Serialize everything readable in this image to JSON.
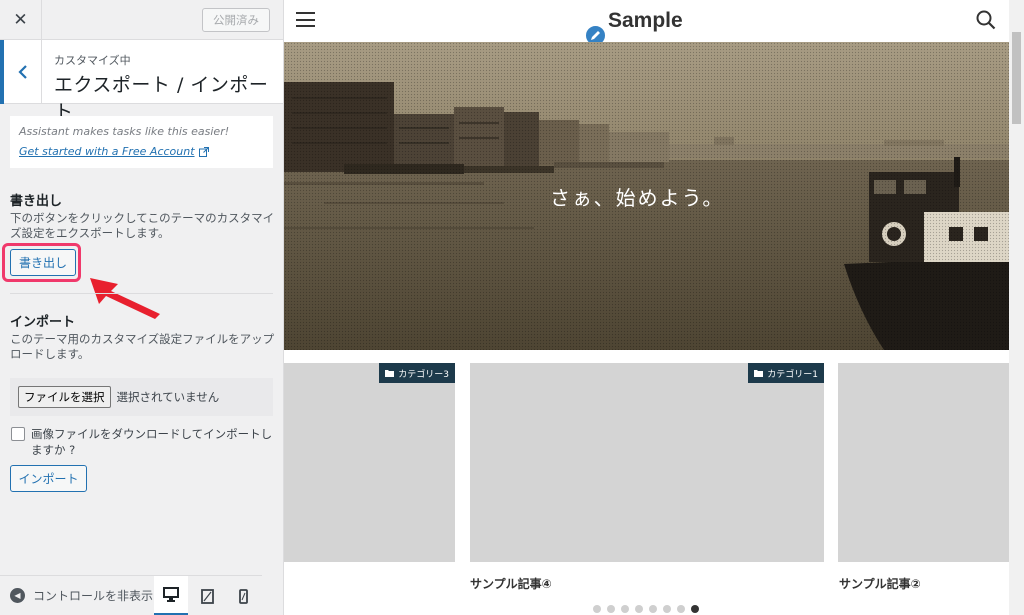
{
  "sidebar": {
    "close_label": "✕",
    "publish_label": "公開済み",
    "customizing_label": "カスタマイズ中",
    "section_title": "エクスポート / インポート",
    "assistant": {
      "text": "Assistant makes tasks like this easier!",
      "link": "Get started with a Free Account"
    },
    "export": {
      "title": "書き出し",
      "description": "下のボタンをクリックしてこのテーマのカスタマイズ設定をエクスポートします。",
      "button": "書き出し"
    },
    "import": {
      "title": "インポート",
      "description": "このテーマ用のカスタマイズ設定ファイルをアップロードします。",
      "file_button": "ファイルを選択",
      "file_status": "選択されていません",
      "checkbox_label": "画像ファイルをダウンロードしてインポートしますか ?",
      "checkbox_checked": false,
      "button": "インポート"
    },
    "footer": {
      "hide_controls": "コントロールを非表示"
    }
  },
  "preview": {
    "site_title": "Sample",
    "hero_tagline": "さぁ、始めよう。",
    "cards": [
      {
        "category": "カテゴリー3",
        "title": ""
      },
      {
        "category": "カテゴリー1",
        "title": "サンプル記事④"
      },
      {
        "category": "",
        "title": "サンプル記事②"
      }
    ],
    "dots_count": 8,
    "active_dot": 7
  },
  "colors": {
    "accent": "#2271b1",
    "highlight": "#f0396b",
    "arrow": "#e8202e",
    "badge": "#1d3a4b"
  }
}
